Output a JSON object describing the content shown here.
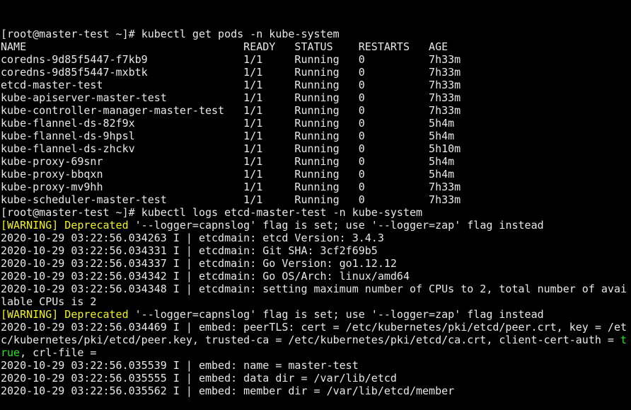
{
  "terminal": {
    "title": "root@master-test terminal",
    "prompt": "[root@master-test ~]#",
    "colors": {
      "background": "#000000",
      "foreground": "#e8e8e8",
      "yellow": "#f3f31e",
      "green": "#1ee81e"
    },
    "commands": [
      "kubectl get pods -n kube-system",
      "kubectl logs etcd-master-test -n kube-system"
    ],
    "pods_table": {
      "headers": [
        "NAME",
        "READY",
        "STATUS",
        "RESTARTS",
        "AGE"
      ],
      "rows": [
        {
          "name": "coredns-9d85f5447-f7kb9",
          "ready": "1/1",
          "status": "Running",
          "restarts": "0",
          "age": "7h33m"
        },
        {
          "name": "coredns-9d85f5447-mxbtk",
          "ready": "1/1",
          "status": "Running",
          "restarts": "0",
          "age": "7h33m"
        },
        {
          "name": "etcd-master-test",
          "ready": "1/1",
          "status": "Running",
          "restarts": "0",
          "age": "7h33m"
        },
        {
          "name": "kube-apiserver-master-test",
          "ready": "1/1",
          "status": "Running",
          "restarts": "0",
          "age": "7h33m"
        },
        {
          "name": "kube-controller-manager-master-test",
          "ready": "1/1",
          "status": "Running",
          "restarts": "0",
          "age": "7h33m"
        },
        {
          "name": "kube-flannel-ds-82f9x",
          "ready": "1/1",
          "status": "Running",
          "restarts": "0",
          "age": "5h4m"
        },
        {
          "name": "kube-flannel-ds-9hpsl",
          "ready": "1/1",
          "status": "Running",
          "restarts": "0",
          "age": "5h4m"
        },
        {
          "name": "kube-flannel-ds-zhckv",
          "ready": "1/1",
          "status": "Running",
          "restarts": "0",
          "age": "5h10m"
        },
        {
          "name": "kube-proxy-69snr",
          "ready": "1/1",
          "status": "Running",
          "restarts": "0",
          "age": "5h4m"
        },
        {
          "name": "kube-proxy-bbqxn",
          "ready": "1/1",
          "status": "Running",
          "restarts": "0",
          "age": "5h4m"
        },
        {
          "name": "kube-proxy-mv9hh",
          "ready": "1/1",
          "status": "Running",
          "restarts": "0",
          "age": "7h33m"
        },
        {
          "name": "kube-scheduler-master-test",
          "ready": "1/1",
          "status": "Running",
          "restarts": "0",
          "age": "7h33m"
        }
      ]
    },
    "log_lines": [
      {
        "id": "warn1",
        "segments": [
          {
            "text": "[WARNING] Deprecated",
            "color": "yellow"
          },
          {
            "text": " '--logger=capnslog' flag is set; use '--logger=zap' flag instead",
            "color": "white"
          }
        ]
      },
      {
        "id": "log1",
        "segments": [
          {
            "text": "2020-10-29 03:22:56.034263 I | etcdmain: etcd Version: 3.4.3",
            "color": "white"
          }
        ]
      },
      {
        "id": "log2",
        "segments": [
          {
            "text": "2020-10-29 03:22:56.034331 I | etcdmain: Git SHA: 3cf2f69b5",
            "color": "white"
          }
        ]
      },
      {
        "id": "log3",
        "segments": [
          {
            "text": "2020-10-29 03:22:56.034337 I | etcdmain: Go Version: go1.12.12",
            "color": "white"
          }
        ]
      },
      {
        "id": "log4",
        "segments": [
          {
            "text": "2020-10-29 03:22:56.034342 I | etcdmain: Go OS/Arch: linux/amd64",
            "color": "white"
          }
        ]
      },
      {
        "id": "log5",
        "segments": [
          {
            "text": "2020-10-29 03:22:56.034348 I | etcdmain: setting maximum number of CPUs to 2, total number of avai",
            "color": "white"
          }
        ]
      },
      {
        "id": "log5wrap",
        "segments": [
          {
            "text": "lable CPUs is 2",
            "color": "white"
          }
        ]
      },
      {
        "id": "warn2",
        "segments": [
          {
            "text": "[WARNING] Deprecated",
            "color": "yellow"
          },
          {
            "text": " '--logger=capnslog' flag is set; use '--logger=zap' flag instead",
            "color": "white"
          }
        ]
      },
      {
        "id": "log6",
        "segments": [
          {
            "text": "2020-10-29 03:22:56.034469 I | embed: peerTLS: cert = /etc/kubernetes/pki/etcd/peer.crt, key = /et",
            "color": "white"
          }
        ]
      },
      {
        "id": "log6wrap1",
        "segments": [
          {
            "text": "c/kubernetes/pki/etcd/peer.key, trusted-ca = /etc/kubernetes/pki/etcd/ca.crt, client-cert-auth = ",
            "color": "white"
          },
          {
            "text": "t",
            "color": "green"
          }
        ]
      },
      {
        "id": "log6wrap2",
        "segments": [
          {
            "text": "rue",
            "color": "green"
          },
          {
            "text": ", crl-file = ",
            "color": "white"
          }
        ]
      },
      {
        "id": "log7",
        "segments": [
          {
            "text": "2020-10-29 03:22:56.035539 I | embed: name = master-test",
            "color": "white"
          }
        ]
      },
      {
        "id": "log8",
        "segments": [
          {
            "text": "2020-10-29 03:22:56.035555 I | embed: data dir = /var/lib/etcd",
            "color": "white"
          }
        ]
      },
      {
        "id": "log9",
        "segments": [
          {
            "text": "2020-10-29 03:22:56.035562 I | embed: member dir = /var/lib/etcd/member",
            "color": "white"
          }
        ]
      }
    ],
    "column_offsets": {
      "name": 0,
      "ready": 38,
      "status": 46,
      "restarts": 56,
      "age": 67
    }
  }
}
